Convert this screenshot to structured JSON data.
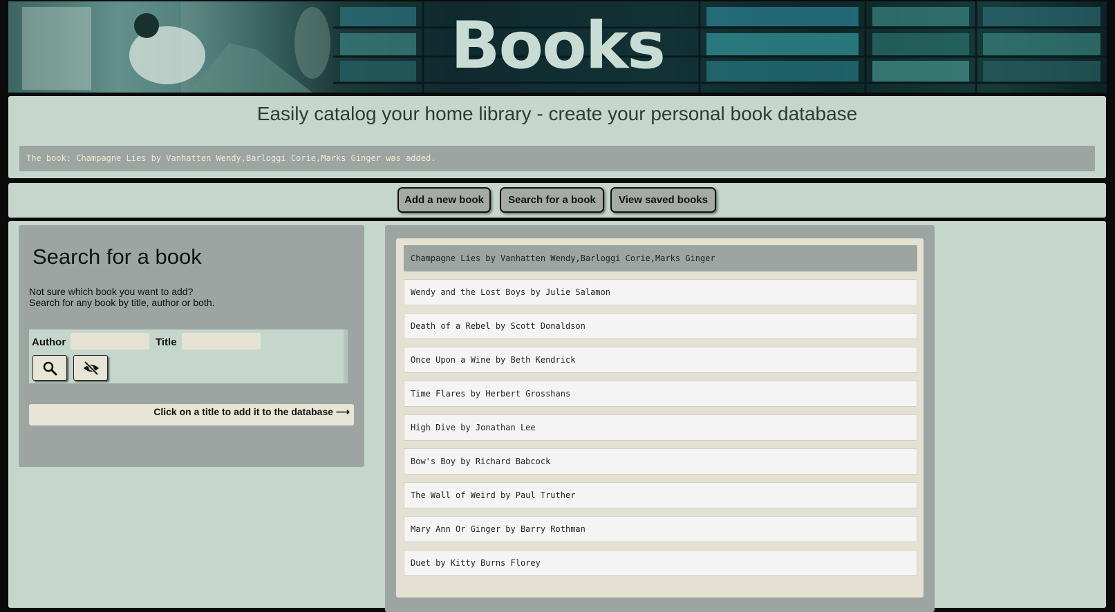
{
  "banner": {
    "title": "Books"
  },
  "intro": {
    "tagline": "Easily catalog your home library - create your personal book database",
    "status": "The book: Champagne Lies by Vanhatten Wendy,Barloggi Corie,Marks Ginger was added."
  },
  "nav": [
    {
      "label": "Add a new book"
    },
    {
      "label": "Search for a book"
    },
    {
      "label": "View saved books"
    }
  ],
  "search": {
    "title": "Search for a book",
    "desc_line1": "Not sure which book you want to add?",
    "desc_line2": "Search for any book by title, author or both.",
    "author_label": "Author",
    "title_label": "Title",
    "author_value": "",
    "title_value": "",
    "search_icon": "search-icon",
    "hide_icon": "eye-off-icon",
    "hint": "Click on a title to add it to the database ⟶"
  },
  "results": [
    {
      "text": "Champagne Lies by Vanhatten Wendy,Barloggi Corie,Marks Ginger",
      "selected": true
    },
    {
      "text": "Wendy and the Lost Boys by Julie Salamon"
    },
    {
      "text": "Death of a Rebel by Scott Donaldson"
    },
    {
      "text": "Once Upon a Wine by Beth Kendrick"
    },
    {
      "text": "Time Flares by Herbert Grosshans"
    },
    {
      "text": "High Dive by Jonathan Lee"
    },
    {
      "text": "Bow's Boy by Richard Babcock"
    },
    {
      "text": "The Wall of Weird by Paul Truther"
    },
    {
      "text": "Mary Ann Or Ginger by Barry Rothman"
    },
    {
      "text": "Duet by Kitty Burns Florey"
    }
  ],
  "colors": {
    "panel": "#c5d6cc",
    "panel_dark": "#9ca5a1",
    "input_bg": "#e6e2d3",
    "status_text": "#ecebd7"
  }
}
